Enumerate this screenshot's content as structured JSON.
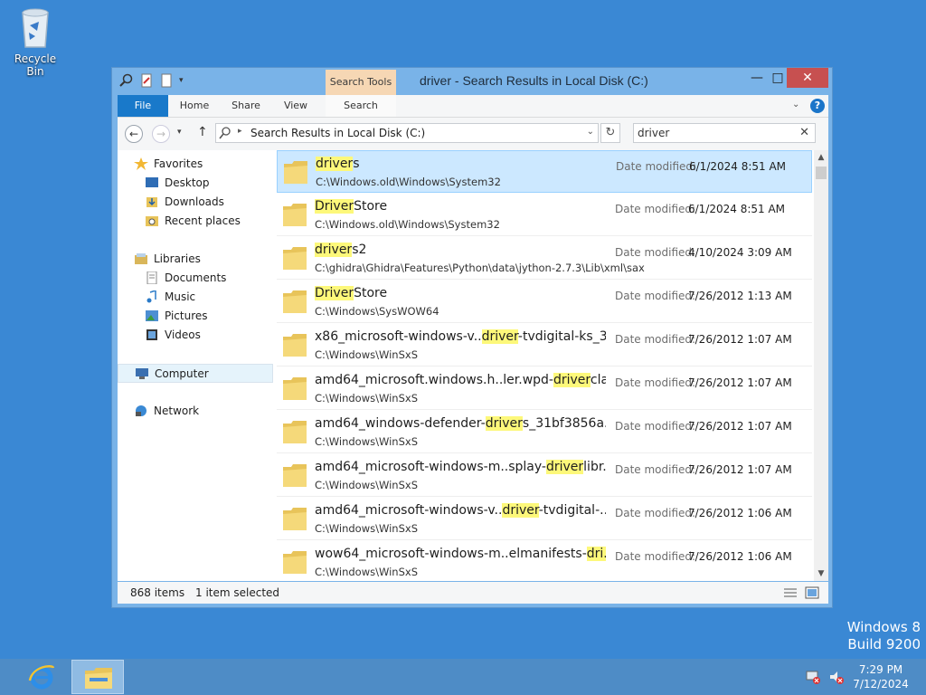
{
  "desktop": {
    "recycle_bin_label": "Recycle Bin",
    "watermark_line1": "Windows 8",
    "watermark_line2": "Build 9200"
  },
  "window": {
    "title": "driver - Search Results in Local Disk (C:)",
    "context_tab_group": "Search Tools",
    "tabs": {
      "file": "File",
      "home": "Home",
      "share": "Share",
      "view": "View",
      "search": "Search"
    },
    "address": "Search Results in Local Disk (C:)",
    "search_value": "driver"
  },
  "nav_pane": {
    "favorites": "Favorites",
    "favorites_items": [
      "Desktop",
      "Downloads",
      "Recent places"
    ],
    "libraries": "Libraries",
    "libraries_items": [
      "Documents",
      "Music",
      "Pictures",
      "Videos"
    ],
    "computer": "Computer",
    "network": "Network"
  },
  "results": {
    "date_label": "Date modified:",
    "rows": [
      {
        "pre": "",
        "hl": "driver",
        "post": "s",
        "path": "C:\\Windows.old\\Windows\\System32",
        "date": "6/1/2024 8:51 AM"
      },
      {
        "pre": "",
        "hl": "Driver",
        "post": "Store",
        "path": "C:\\Windows.old\\Windows\\System32",
        "date": "6/1/2024 8:51 AM"
      },
      {
        "pre": "",
        "hl": "driver",
        "post": "s2",
        "path": "C:\\ghidra\\Ghidra\\Features\\Python\\data\\jython-2.7.3\\Lib\\xml\\sax",
        "date": "4/10/2024 3:09 AM"
      },
      {
        "pre": "",
        "hl": "Driver",
        "post": "Store",
        "path": "C:\\Windows\\SysWOW64",
        "date": "7/26/2012 1:13 AM"
      },
      {
        "pre": "x86_microsoft-windows-v..",
        "hl": "driver",
        "post": "-tvdigital-ks_3...",
        "path": "C:\\Windows\\WinSxS",
        "date": "7/26/2012 1:07 AM"
      },
      {
        "pre": "amd64_microsoft.windows.h..ler.wpd-",
        "hl": "driver",
        "post": "cla...",
        "path": "C:\\Windows\\WinSxS",
        "date": "7/26/2012 1:07 AM"
      },
      {
        "pre": "amd64_windows-defender-",
        "hl": "driver",
        "post": "s_31bf3856a...",
        "path": "C:\\Windows\\WinSxS",
        "date": "7/26/2012 1:07 AM"
      },
      {
        "pre": "amd64_microsoft-windows-m..splay-",
        "hl": "driver",
        "post": "libr...",
        "path": "C:\\Windows\\WinSxS",
        "date": "7/26/2012 1:07 AM"
      },
      {
        "pre": "amd64_microsoft-windows-v..",
        "hl": "driver",
        "post": "-tvdigital-...",
        "path": "C:\\Windows\\WinSxS",
        "date": "7/26/2012 1:06 AM"
      },
      {
        "pre": "wow64_microsoft-windows-m..elmanifests-",
        "hl": "dri...",
        "post": "",
        "path": "C:\\Windows\\WinSxS",
        "date": "7/26/2012 1:06 AM"
      }
    ]
  },
  "status": {
    "count": "868 items",
    "selection": "1 item selected"
  },
  "taskbar": {
    "time": "7:29 PM",
    "date": "7/12/2024"
  },
  "colors": {
    "desktop": "#3a88d4",
    "highlight": "#fdf87a",
    "selection": "#cce8ff",
    "file_tab": "#1979ca",
    "close_button": "#c75050",
    "context_tab": "#f6d7b4"
  },
  "icons": [
    "recycle-bin-icon",
    "folder-icon",
    "star-icon",
    "desktop-icon",
    "downloads-icon",
    "recent-places-icon",
    "libraries-icon",
    "documents-icon",
    "music-icon",
    "pictures-icon",
    "videos-icon",
    "computer-icon",
    "network-icon",
    "internet-explorer-icon",
    "file-explorer-icon",
    "network-tray-icon",
    "volume-tray-icon"
  ]
}
